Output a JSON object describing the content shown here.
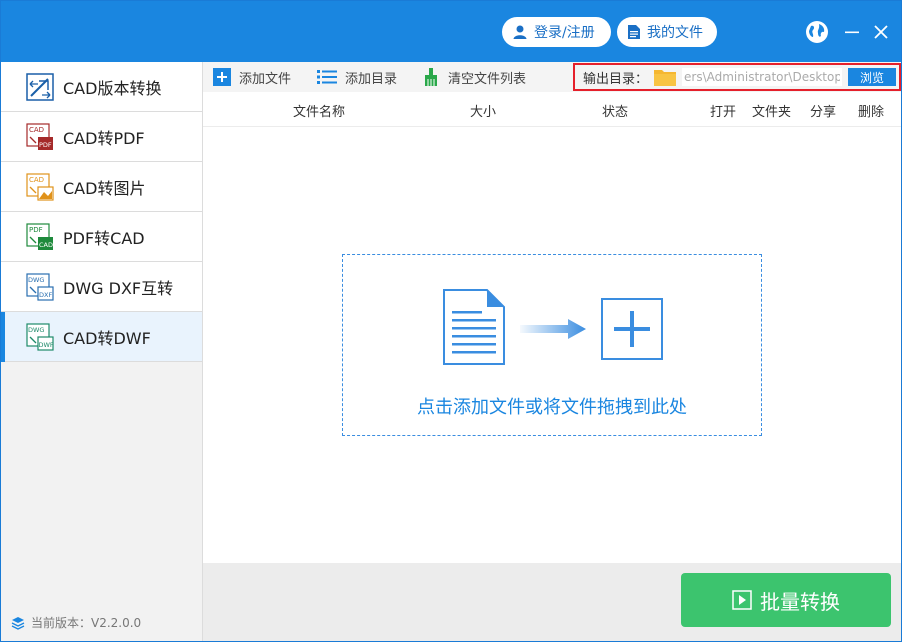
{
  "titlebar": {
    "login_label": "登录/注册",
    "files_label": "我的文件"
  },
  "sidebar": {
    "items": [
      {
        "label": "CAD版本转换",
        "icon": "cad-version-convert-icon",
        "active": false
      },
      {
        "label": "CAD转PDF",
        "icon": "cad-to-pdf-icon",
        "active": false
      },
      {
        "label": "CAD转图片",
        "icon": "cad-to-image-icon",
        "active": false
      },
      {
        "label": "PDF转CAD",
        "icon": "pdf-to-cad-icon",
        "active": false
      },
      {
        "label": "DWG DXF互转",
        "icon": "dwg-dxf-convert-icon",
        "active": false
      },
      {
        "label": "CAD转DWF",
        "icon": "cad-to-dwf-icon",
        "active": true
      }
    ],
    "version": "当前版本：V2.2.0.0"
  },
  "toolbar": {
    "add_file": "添加文件",
    "add_dir": "添加目录",
    "clear_list": "清空文件列表",
    "output_label": "输出目录：",
    "output_path": "ers\\Administrator\\Desktop",
    "browse": "浏览"
  },
  "table": {
    "columns": [
      "文件名称",
      "大小",
      "状态",
      "打开",
      "文件夹",
      "分享",
      "删除"
    ]
  },
  "dropzone": {
    "text": "点击添加文件或将文件拖拽到此处"
  },
  "footer": {
    "convert": "批量转换"
  },
  "colors": {
    "accent": "#1a86e0",
    "highlight_border": "#e5202b",
    "convert_button": "#3cc46e"
  }
}
